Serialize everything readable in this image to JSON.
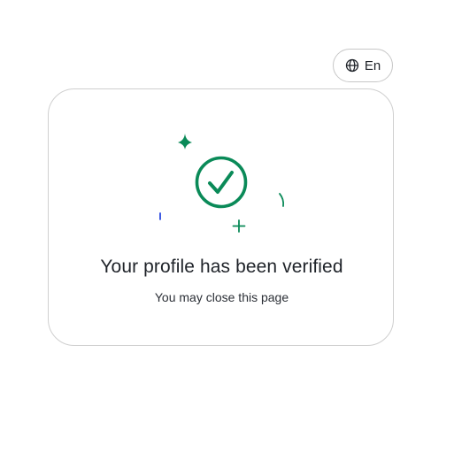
{
  "language_selector": {
    "label": "En",
    "icon": "globe-icon"
  },
  "verification_card": {
    "title": "Your profile has been verified",
    "subtitle": "You may close this page",
    "status_icon": "check-circle-icon"
  },
  "colors": {
    "accent_green": "#0a8a58",
    "confetti_blue": "#2b49e0",
    "text_primary": "#1f2329",
    "border": "#cfcfcf"
  }
}
